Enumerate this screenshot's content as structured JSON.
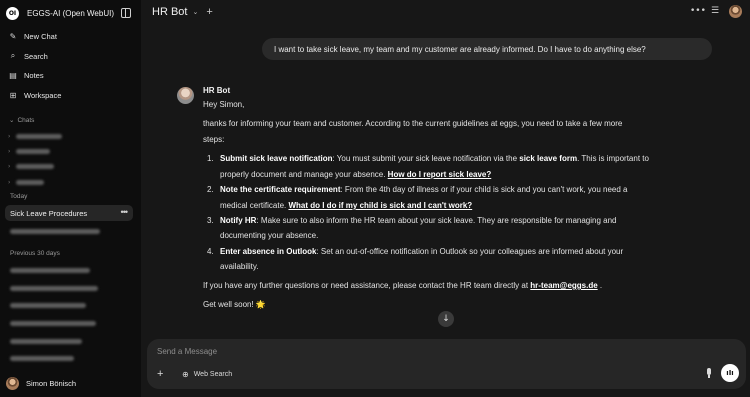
{
  "app": {
    "brand_name": "EGGS-AI (Open WebUI)",
    "logo_text": "OI"
  },
  "sidebar": {
    "nav": [
      {
        "label": "New Chat",
        "icon": "edit-icon"
      },
      {
        "label": "Search",
        "icon": "search-icon"
      },
      {
        "label": "Notes",
        "icon": "notes-icon"
      },
      {
        "label": "Workspace",
        "icon": "workspace-icon"
      }
    ],
    "chats_label": "Chats",
    "today_label": "Today",
    "active_chat": "Sick Leave Procedures",
    "previous_label": "Previous 30 days",
    "user_name": "Simon Bönisch"
  },
  "header": {
    "title": "HR Bot"
  },
  "conversation": {
    "user_message": "I want to take sick leave, my team and my customer are already informed. Do I have to do anything else?",
    "bot_name": "HR Bot",
    "greeting": "Hey Simon,",
    "intro_line1": "thanks for informing your team and customer. According to the current guidelines at eggs, you need to take a few more",
    "intro_line2": "steps:",
    "steps": [
      {
        "num": "1.",
        "title": "Submit sick leave notification",
        "line1_a": ": You must submit your sick leave notification via the ",
        "line1_bold": "sick leave form",
        "line1_b": ". This is important to",
        "line2": "properly document and manage your absence. ",
        "link": "How do I report sick leave?"
      },
      {
        "num": "2.",
        "title": "Note the certificate requirement",
        "line1": ": From the 4th day of illness or if your child is sick and you can't work, you need a",
        "line2": "medical certificate. ",
        "link": "What do I do if my child is sick and I can't work?"
      },
      {
        "num": "3.",
        "title": "Notify HR",
        "line1": ": Make sure to also inform the HR team about your sick leave. They are responsible for managing and",
        "line2": "documenting your absence."
      },
      {
        "num": "4.",
        "title": "Enter absence in Outlook",
        "line1": ": Set an out-of-office notification in Outlook so your colleagues are informed about your",
        "line2": "availability."
      }
    ],
    "contact_text": "If you have any further questions or need assistance, please contact the HR team directly at ",
    "contact_email": "hr-team@eggs.de",
    "contact_end": " .",
    "closing": "Get well soon! 🌟"
  },
  "composer": {
    "placeholder": "Send a Message",
    "web_search_label": "Web Search"
  }
}
